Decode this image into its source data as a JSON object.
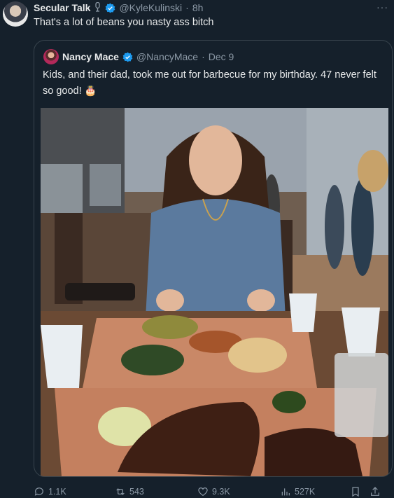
{
  "tweet": {
    "display_name": "Secular Talk",
    "name_icon": "microphone-icon",
    "handle": "@KyleKulinski",
    "separator": "·",
    "time": "8h",
    "text": "That's a lot of beans you nasty ass bitch",
    "more": "···"
  },
  "quote": {
    "display_name": "Nancy Mace",
    "handle": "@NancyMace",
    "separator": "·",
    "date": "Dec 9",
    "text": "Kids, and their dad, took me out for barbecue for my birthday. 47 never felt so good!",
    "emoji": "🎂"
  },
  "actions": {
    "replies": "1.1K",
    "reposts": "543",
    "likes": "9.3K",
    "views": "527K"
  },
  "colors": {
    "background": "#15202b",
    "verified": "#1d9bf0",
    "secondary_text": "#8b98a5",
    "border": "#38444d"
  }
}
